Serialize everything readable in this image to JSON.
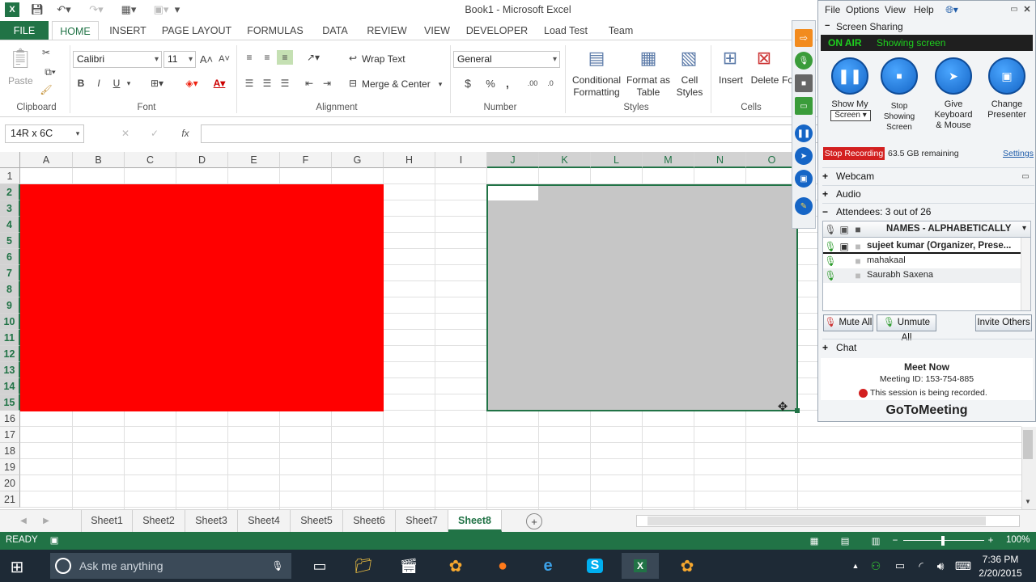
{
  "window": {
    "title": "Book1 - Microsoft Excel"
  },
  "tabs": [
    "FILE",
    "HOME",
    "INSERT",
    "PAGE LAYOUT",
    "FORMULAS",
    "DATA",
    "REVIEW",
    "VIEW",
    "DEVELOPER",
    "Load Test",
    "Team"
  ],
  "ribbon": {
    "clipboard": {
      "paste": "Paste",
      "label": "Clipboard"
    },
    "font": {
      "name": "Calibri",
      "size": "11",
      "bold": "B",
      "italic": "I",
      "underline": "U",
      "label": "Font"
    },
    "alignment": {
      "wrap": "Wrap Text",
      "merge": "Merge & Center",
      "label": "Alignment"
    },
    "number": {
      "format": "General",
      "currency": "$",
      "percent": "%",
      "comma": ",",
      "label": "Number"
    },
    "styles": {
      "conditional": "Conditional\nFormatting",
      "format_table": "Format as\nTable",
      "cell_styles": "Cell\nStyles",
      "label": "Styles"
    },
    "cells": {
      "insert": "Insert",
      "delete": "Delete",
      "format": "Fo",
      "label": "Cells"
    }
  },
  "formula_bar": {
    "name_box": "14R x 6C",
    "fx": "fx",
    "value": ""
  },
  "grid": {
    "columns": [
      "A",
      "B",
      "C",
      "D",
      "E",
      "F",
      "G",
      "H",
      "I",
      "J",
      "K",
      "L",
      "M",
      "N",
      "O"
    ],
    "rows": [
      "1",
      "2",
      "3",
      "4",
      "5",
      "6",
      "7",
      "8",
      "9",
      "10",
      "11",
      "12",
      "13",
      "14",
      "15",
      "16",
      "17",
      "18",
      "19",
      "20",
      "21"
    ],
    "selected_columns": [
      "J",
      "K",
      "L",
      "M",
      "N",
      "O"
    ],
    "selected_rows": [
      "2",
      "3",
      "4",
      "5",
      "6",
      "7",
      "8",
      "9",
      "10",
      "11",
      "12",
      "13",
      "14",
      "15"
    ],
    "red_fill": "#ff0000",
    "selection_fill": "#c6c6c6"
  },
  "sheets": [
    "Sheet1",
    "Sheet2",
    "Sheet3",
    "Sheet4",
    "Sheet5",
    "Sheet6",
    "Sheet7",
    "Sheet8"
  ],
  "active_sheet": "Sheet8",
  "status": {
    "mode": "READY",
    "zoom": "100%"
  },
  "taskbar": {
    "search_placeholder": "Ask me anything",
    "time": "7:36 PM",
    "date": "2/20/2015"
  },
  "gotomeeting": {
    "menu": [
      "File",
      "Options",
      "View",
      "Help"
    ],
    "screen_sharing": "Screen Sharing",
    "on_air": "ON AIR",
    "showing": "Showing screen",
    "show_my": "Show My",
    "screen_select": "Screen",
    "stop_showing": "Stop\nShowing\nScreen",
    "give_keyboard": "Give\nKeyboard\n& Mouse",
    "change_presenter": "Change\nPresenter",
    "stop_recording": "Stop Recording",
    "remaining": "63.5 GB remaining",
    "settings": "Settings",
    "webcam": "Webcam",
    "audio": "Audio",
    "attendees": "Attendees:  3 out of 26",
    "names_header": "NAMES - ALPHABETICALLY",
    "attendee_list": [
      "sujeet kumar (Organizer, Prese...",
      "mahakaal",
      "Saurabh Saxena"
    ],
    "mute_all": "Mute All",
    "unmute_all": "Unmute All",
    "invite": "Invite Others",
    "chat": "Chat",
    "meet_now": "Meet Now",
    "meeting_id": "Meeting ID: 153-754-885",
    "recorded": "This session is being recorded.",
    "brand": "GoToMeeting"
  }
}
